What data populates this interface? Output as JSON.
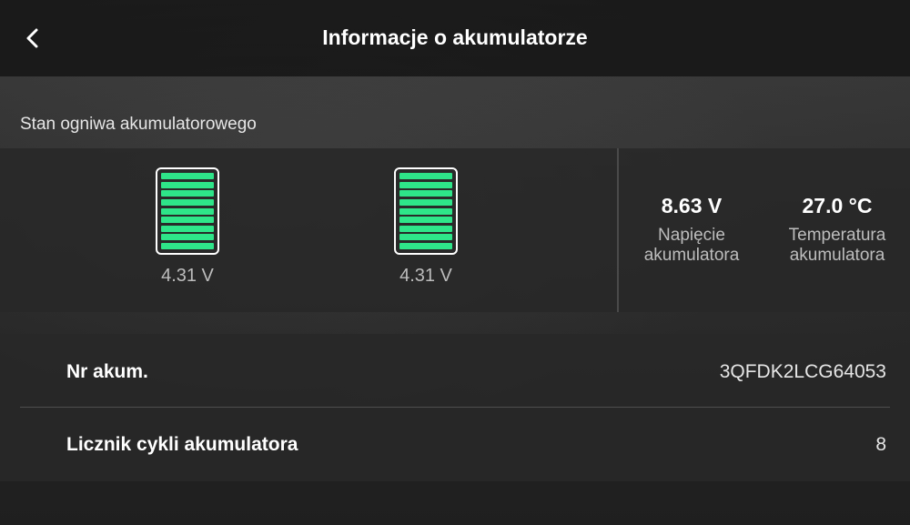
{
  "header": {
    "title": "Informacje o akumulatorze",
    "back_icon": "chevron-left-icon"
  },
  "cell_status": {
    "section_label": "Stan ogniwa akumulatorowego",
    "cells": [
      {
        "voltage": "4.31 V",
        "charge_level": 1.0
      },
      {
        "voltage": "4.31 V",
        "charge_level": 1.0
      }
    ],
    "bar_color": "#2ee589"
  },
  "battery_voltage": {
    "value": "8.63 V",
    "label": "Napięcie akumulatora"
  },
  "battery_temperature": {
    "value": "27.0 °C",
    "label": "Temperatura akumulatora"
  },
  "info": {
    "rows": [
      {
        "label": "Nr akum.",
        "value": "3QFDK2LCG64053"
      },
      {
        "label": "Licznik cykli akumulatora",
        "value": "8"
      }
    ]
  }
}
